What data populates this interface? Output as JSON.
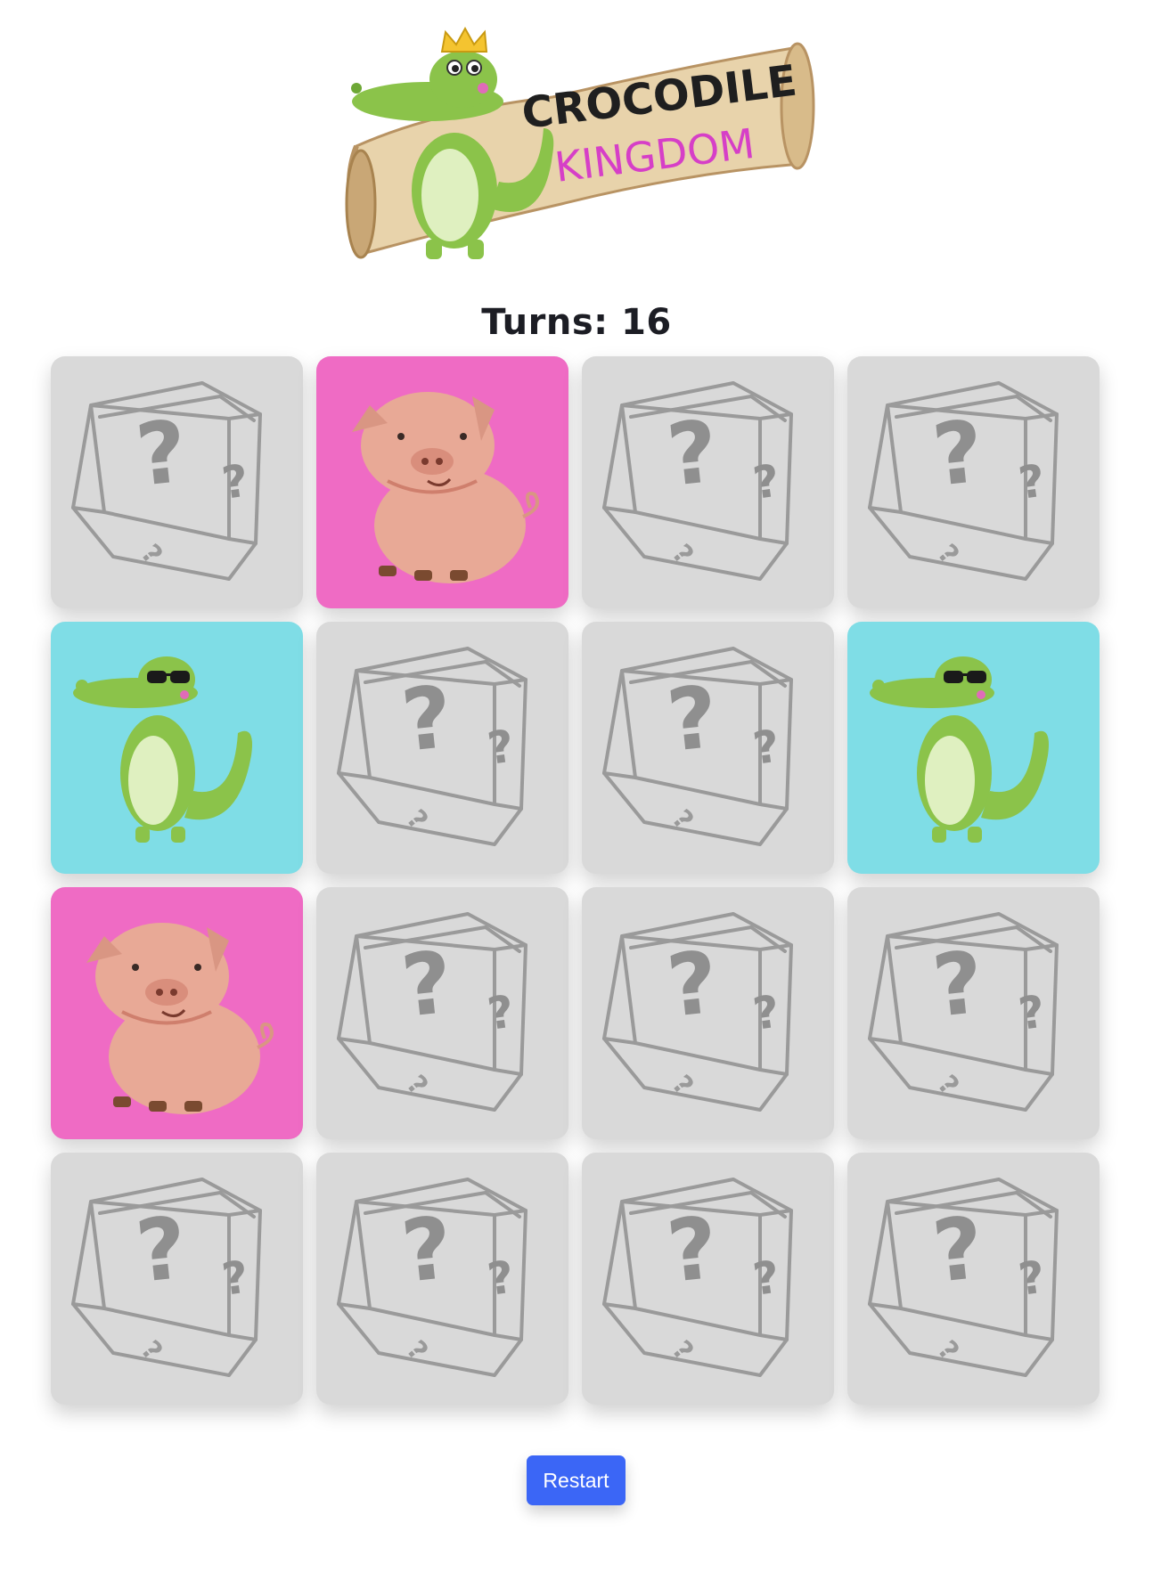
{
  "logo": {
    "line1": "CROCODILE",
    "line2": "KINGDOM",
    "colors": {
      "line1": "#1f1f1f",
      "line2": "#d63fc7",
      "croc": "#8bc34a",
      "belly": "#dff0c0",
      "banner": "#e5cfa6"
    }
  },
  "status": {
    "turns_label": "Turns: 16",
    "turns": 16
  },
  "board": {
    "rows": 4,
    "columns": 4,
    "cards": [
      {
        "state": "hidden"
      },
      {
        "state": "revealed",
        "animal": "pig"
      },
      {
        "state": "hidden"
      },
      {
        "state": "hidden"
      },
      {
        "state": "revealed",
        "animal": "crocodile-sunglasses"
      },
      {
        "state": "hidden"
      },
      {
        "state": "hidden"
      },
      {
        "state": "revealed",
        "animal": "crocodile-sunglasses"
      },
      {
        "state": "revealed",
        "animal": "pig"
      },
      {
        "state": "hidden"
      },
      {
        "state": "hidden"
      },
      {
        "state": "hidden"
      },
      {
        "state": "hidden"
      },
      {
        "state": "hidden"
      },
      {
        "state": "hidden"
      },
      {
        "state": "hidden"
      }
    ],
    "card_back_icon": "question-cube-icon",
    "colors": {
      "hidden": "#d9d9d9",
      "pig": "#ef6bc4",
      "crocodile": "#7fdde6"
    }
  },
  "actions": {
    "restart_label": "Restart",
    "restart_color": "#3b66f6"
  }
}
